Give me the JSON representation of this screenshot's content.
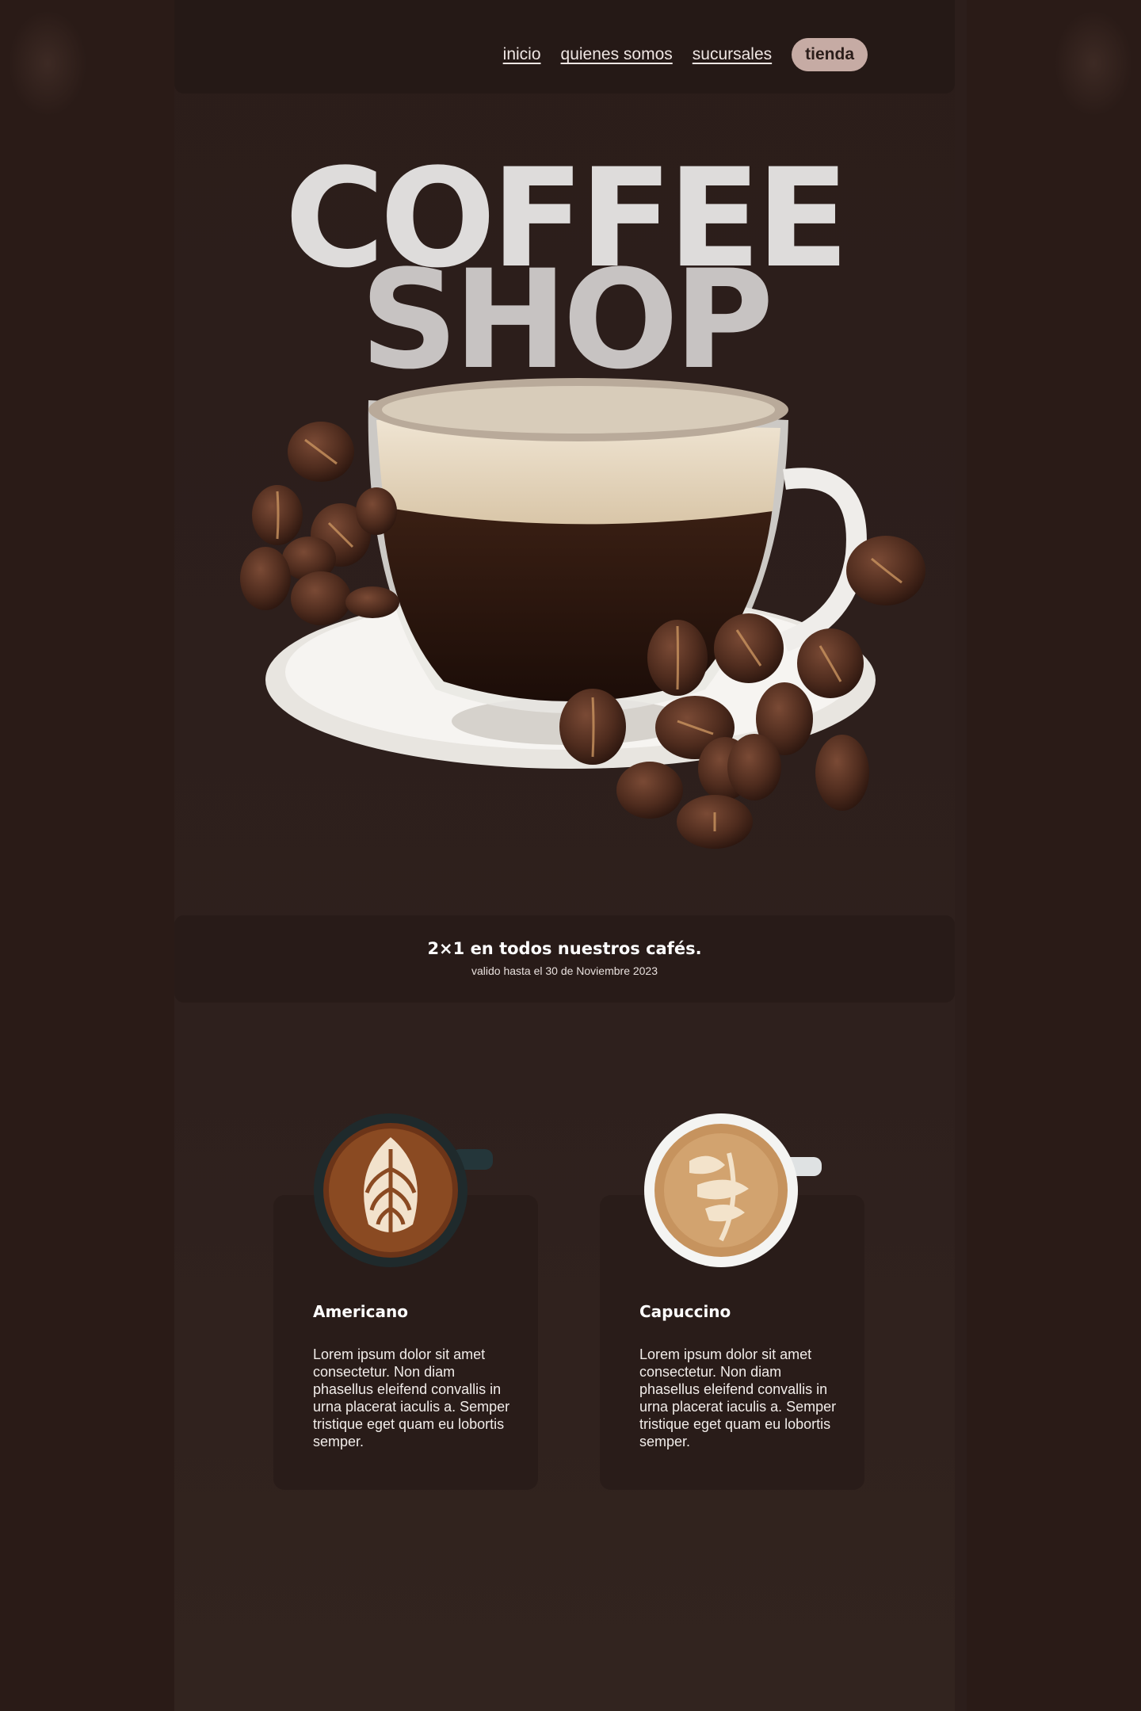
{
  "nav": {
    "links": [
      "inicio",
      "quienes somos",
      "sucursales"
    ],
    "cta": "tienda"
  },
  "hero": {
    "title_line1": "COFFEE",
    "title_line2": "SHOP",
    "image": "coffee-cup-with-beans"
  },
  "promo": {
    "title": "2×1 en todos nuestros cafés.",
    "subtitle": "valido hasta el 30 de Noviembre 2023"
  },
  "products": [
    {
      "name": "Americano",
      "image": "latte-art-dark-mug",
      "description": "Lorem ipsum dolor sit amet consectetur. Non diam phasellus eleifend convallis in urna placerat iaculis a. Semper tristique eget quam eu lobortis semper."
    },
    {
      "name": "Capuccino",
      "image": "latte-art-white-cup",
      "description": "Lorem ipsum dolor sit amet consectetur. Non diam phasellus eleifend convallis in urna placerat iaculis a. Semper tristique eget quam eu lobortis semper."
    }
  ],
  "colors": {
    "background": "#2c1e1b",
    "nav": "#251916",
    "pill": "#c6aba4",
    "card": "#291c19"
  }
}
